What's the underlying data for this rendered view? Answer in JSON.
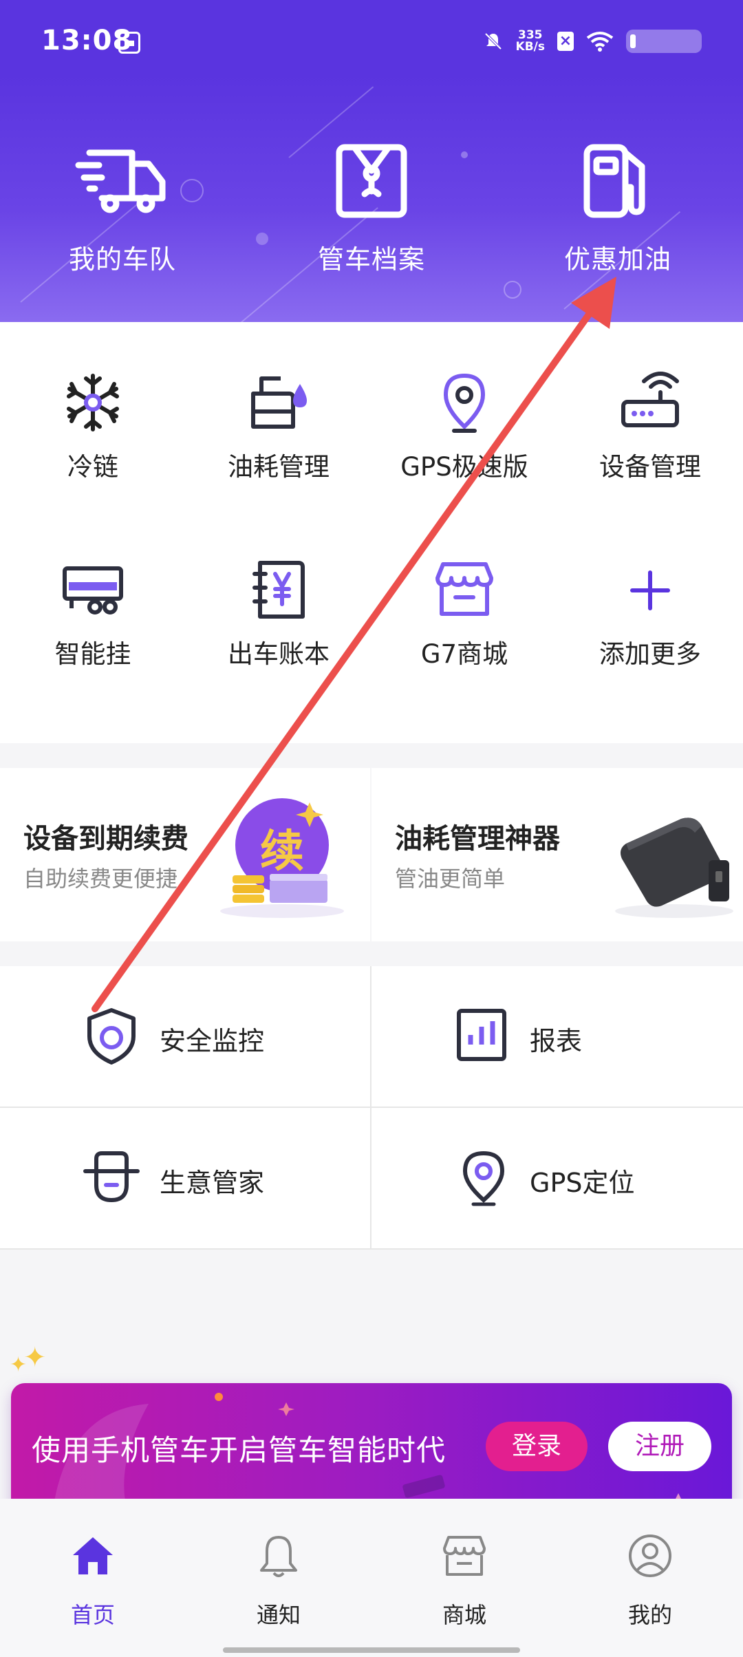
{
  "status_bar": {
    "time": "13:08",
    "net_speed_value": "335",
    "net_speed_unit": "KB/s"
  },
  "header_actions": [
    {
      "label": "我的车队",
      "icon": "truck-icon"
    },
    {
      "label": "管车档案",
      "icon": "archive-envelope-icon"
    },
    {
      "label": "优惠加油",
      "icon": "fuel-pump-icon"
    }
  ],
  "features": [
    {
      "label": "冷链",
      "icon": "snowflake-icon"
    },
    {
      "label": "油耗管理",
      "icon": "fuel-tank-drop-icon"
    },
    {
      "label": "GPS极速版",
      "icon": "location-pin-icon"
    },
    {
      "label": "设备管理",
      "icon": "router-device-icon"
    },
    {
      "label": "智能挂",
      "icon": "trailer-icon"
    },
    {
      "label": "出车账本",
      "icon": "ledger-yen-icon"
    },
    {
      "label": "G7商城",
      "icon": "storefront-icon"
    },
    {
      "label": "添加更多",
      "icon": "plus-icon"
    }
  ],
  "promos": [
    {
      "title": "设备到期续费",
      "subtitle": "自助续费更便捷",
      "badge": "续"
    },
    {
      "title": "油耗管理神器",
      "subtitle": "管油更简单"
    }
  ],
  "tools": [
    {
      "label": "安全监控",
      "icon": "shield-icon"
    },
    {
      "label": "报表",
      "icon": "bar-report-icon"
    },
    {
      "label": "生意管家",
      "icon": "manager-person-icon"
    },
    {
      "label": "GPS定位",
      "icon": "gps-pin-icon"
    }
  ],
  "banner": {
    "text": "使用手机管车开启管车智能时代",
    "login_label": "登录",
    "register_label": "注册"
  },
  "bottom_nav": [
    {
      "label": "首页",
      "icon": "home-icon",
      "active": true
    },
    {
      "label": "通知",
      "icon": "bell-icon",
      "active": false
    },
    {
      "label": "商城",
      "icon": "store-icon",
      "active": false
    },
    {
      "label": "我的",
      "icon": "profile-icon",
      "active": false
    }
  ],
  "colors": {
    "brand_purple": "#5a34df",
    "accent_pink": "#e31f8f",
    "annotation_red": "#ec4f4c"
  }
}
